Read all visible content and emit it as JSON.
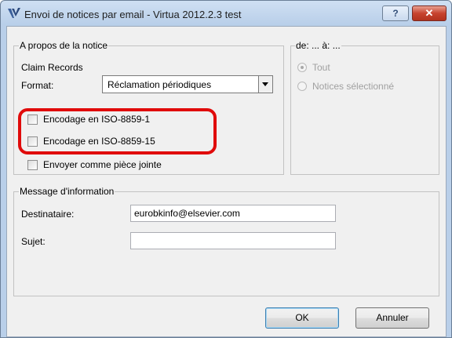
{
  "window": {
    "title": "Envoi de notices par email - Virtua 2012.2.3 test",
    "help_label": "?",
    "close_label": "✕"
  },
  "about": {
    "legend": "A propos de la notice",
    "record_type": "Claim Records",
    "format_label": "Format:",
    "format_value": "Réclamation périodiques",
    "checkboxes": [
      {
        "label": "Encodage en ISO-8859-1",
        "checked": false
      },
      {
        "label": "Encodage en ISO-8859-15",
        "checked": false
      },
      {
        "label": "Envoyer comme pièce jointe",
        "checked": false
      }
    ]
  },
  "range": {
    "legend": "de: ... à: ...",
    "options": [
      {
        "label": "Tout",
        "selected": true,
        "enabled": false
      },
      {
        "label": "Notices sélectionné",
        "selected": false,
        "enabled": false
      }
    ]
  },
  "message": {
    "legend": "Message d'information",
    "recipient_label": "Destinataire:",
    "recipient_value": "eurobkinfo@elsevier.com",
    "subject_label": "Sujet:",
    "subject_value": ""
  },
  "buttons": {
    "ok": "OK",
    "cancel": "Annuler"
  },
  "colors": {
    "highlight": "#e00b0b"
  }
}
